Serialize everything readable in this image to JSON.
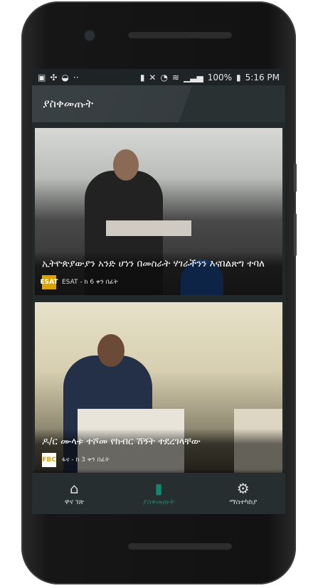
{
  "status_bar": {
    "battery": "100%",
    "time": "5:16 PM"
  },
  "app_bar": {
    "title": "ያስቀመጡት"
  },
  "articles": [
    {
      "title": "ኢትዮጵያውያን አንድ ሆነን በመስራት ሃገራችንን እናበልጽግ ተባለ",
      "source_logo": "ESAT",
      "meta": "ESAT - ከ 6 ቀን በፊት"
    },
    {
      "title": "ዶ/ር ሙላቱ ተሾመ የክብር ሽኝት ተደረገላቸው",
      "source_logo": "FBC",
      "meta": "ፋና - ከ 3 ቀን በፊት"
    }
  ],
  "bottom_nav": [
    {
      "label": "ዋና ገጽ",
      "icon": "home-icon",
      "active": false
    },
    {
      "label": "ያስቀመጡት",
      "icon": "bookmark-icon",
      "active": true
    },
    {
      "label": "ማስተካከያ",
      "icon": "gear-icon",
      "active": false
    }
  ],
  "colors": {
    "accent": "#13876f",
    "background": "#23292b"
  }
}
